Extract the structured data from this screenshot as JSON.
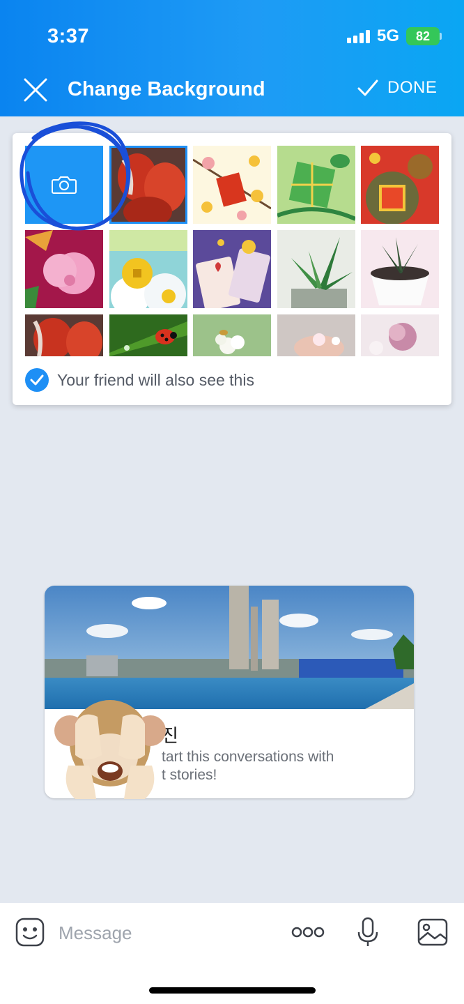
{
  "status_bar": {
    "time": "3:37",
    "network": "5G",
    "battery": "82"
  },
  "header": {
    "title": "Change Background",
    "done_label": "DONE"
  },
  "picker": {
    "tiles": [
      "camera",
      "tulip",
      "spring-blossom",
      "rice-cake",
      "red-envelope",
      "pink-flower",
      "coin-cloud",
      "heart-cards",
      "succulent",
      "potted-succulent",
      "tulip",
      "ladybug",
      "white-flowers",
      "hand-blossom",
      "pink-petals"
    ],
    "friend_notice": "Your friend will also see this"
  },
  "story": {
    "name": "진",
    "text": "tart this conversations with\nt stories!"
  },
  "input": {
    "placeholder": "Message"
  },
  "colors": {
    "accent": "#1e8ff5",
    "header_start": "#0a84f0",
    "header_end": "#0aa6f3",
    "battery": "#34c759"
  }
}
